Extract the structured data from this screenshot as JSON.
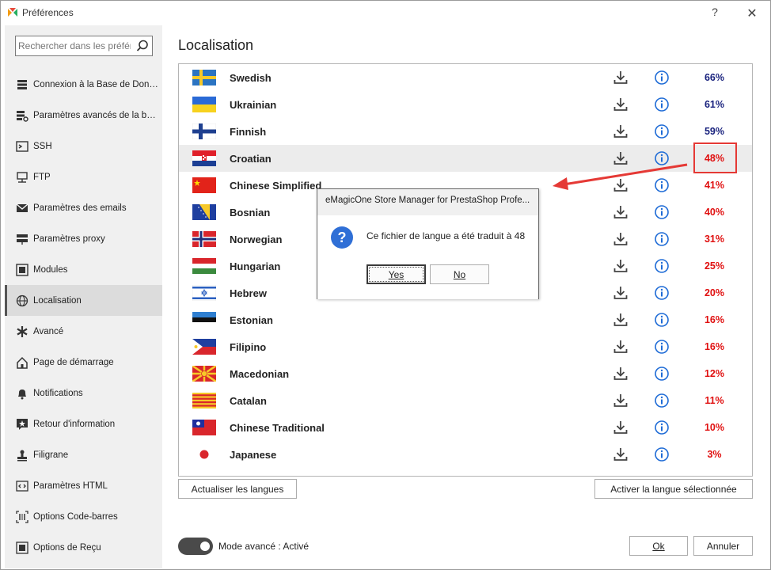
{
  "window": {
    "title": "Préférences",
    "help": "?",
    "close": "✕"
  },
  "sidebar": {
    "search_placeholder": "Rechercher dans les préférences",
    "items": [
      {
        "label": "Connexion à la Base de Données",
        "icon": "database-icon"
      },
      {
        "label": "Paramètres avancés de la base de données",
        "icon": "database-settings-icon"
      },
      {
        "label": "SSH",
        "icon": "terminal-icon"
      },
      {
        "label": "FTP",
        "icon": "ftp-icon"
      },
      {
        "label": "Paramètres des emails",
        "icon": "email-icon"
      },
      {
        "label": "Paramètres proxy",
        "icon": "proxy-icon"
      },
      {
        "label": "Modules",
        "icon": "modules-icon"
      },
      {
        "label": "Localisation",
        "icon": "globe-icon",
        "active": true
      },
      {
        "label": "Avancé",
        "icon": "asterisk-icon"
      },
      {
        "label": "Page de démarrage",
        "icon": "home-icon"
      },
      {
        "label": "Notifications",
        "icon": "bell-icon"
      },
      {
        "label": "Retour d'information",
        "icon": "feedback-icon"
      },
      {
        "label": "Filigrane",
        "icon": "stamp-icon"
      },
      {
        "label": "Paramètres HTML",
        "icon": "code-icon"
      },
      {
        "label": "Options Code-barres",
        "icon": "barcode-icon"
      },
      {
        "label": "Options de Reçu",
        "icon": "receipt-icon"
      }
    ]
  },
  "main": {
    "title": "Localisation",
    "languages": [
      {
        "name": "Swedish",
        "flag": "se",
        "percent": "66%",
        "status": "good"
      },
      {
        "name": "Ukrainian",
        "flag": "ua",
        "percent": "61%",
        "status": "good"
      },
      {
        "name": "Finnish",
        "flag": "fi",
        "percent": "59%",
        "status": "good"
      },
      {
        "name": "Croatian",
        "flag": "hr",
        "percent": "48%",
        "status": "bad",
        "selected": true
      },
      {
        "name": "Chinese Simplified",
        "flag": "cn",
        "percent": "41%",
        "status": "bad"
      },
      {
        "name": "Bosnian",
        "flag": "ba",
        "percent": "40%",
        "status": "bad"
      },
      {
        "name": "Norwegian",
        "flag": "no",
        "percent": "31%",
        "status": "bad"
      },
      {
        "name": "Hungarian",
        "flag": "hu",
        "percent": "25%",
        "status": "bad"
      },
      {
        "name": "Hebrew",
        "flag": "il",
        "percent": "20%",
        "status": "bad"
      },
      {
        "name": "Estonian",
        "flag": "ee",
        "percent": "16%",
        "status": "bad"
      },
      {
        "name": "Filipino",
        "flag": "ph",
        "percent": "16%",
        "status": "bad"
      },
      {
        "name": "Macedonian",
        "flag": "mk",
        "percent": "12%",
        "status": "bad"
      },
      {
        "name": "Catalan",
        "flag": "ct",
        "percent": "11%",
        "status": "bad"
      },
      {
        "name": "Chinese Traditional",
        "flag": "tw",
        "percent": "10%",
        "status": "bad"
      },
      {
        "name": "Japanese",
        "flag": "jp",
        "percent": "3%",
        "status": "bad"
      }
    ],
    "refresh_label": "Actualiser les langues",
    "activate_label": "Activer la langue sélectionnée",
    "advanced_mode_label": "Mode avancé : Activé",
    "advanced_mode_on": true,
    "ok_label": "Ok",
    "cancel_label": "Annuler"
  },
  "dialog": {
    "title": "eMagicOne Store Manager for PrestaShop Profe...",
    "message": "Ce fichier de langue a été traduit à 48",
    "yes_label": "Yes",
    "no_label": "No"
  },
  "colors": {
    "good_percent": "#1a237e",
    "bad_percent": "#e01010",
    "annotation": "#e53935",
    "info_blue": "#1e6bd6"
  }
}
